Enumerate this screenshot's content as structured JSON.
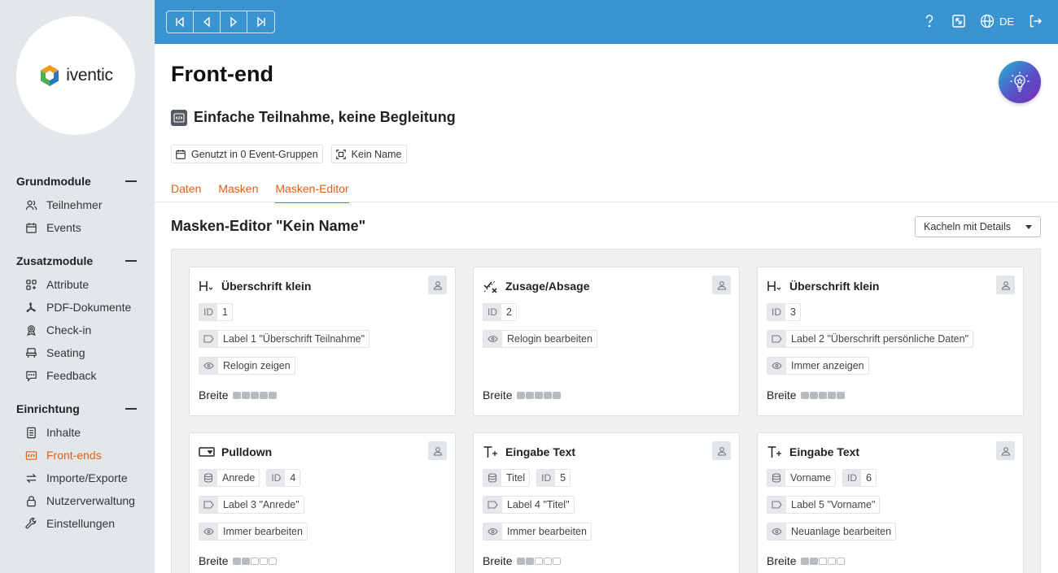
{
  "brand": {
    "name": "iventic"
  },
  "sidebar": {
    "groups": [
      {
        "title": "Grundmodule",
        "items": [
          {
            "label": "Teilnehmer",
            "icon": "users-icon"
          },
          {
            "label": "Events",
            "icon": "calendar-icon"
          }
        ]
      },
      {
        "title": "Zusatzmodule",
        "items": [
          {
            "label": "Attribute",
            "icon": "grid-plus-icon"
          },
          {
            "label": "PDF-Dokumente",
            "icon": "pdf-icon"
          },
          {
            "label": "Check-in",
            "icon": "badge-icon"
          },
          {
            "label": "Seating",
            "icon": "seat-icon"
          },
          {
            "label": "Feedback",
            "icon": "feedback-icon"
          }
        ]
      },
      {
        "title": "Einrichtung",
        "items": [
          {
            "label": "Inhalte",
            "icon": "document-icon"
          },
          {
            "label": "Front-ends",
            "icon": "frontend-icon",
            "active": true
          },
          {
            "label": "Importe/Exporte",
            "icon": "swap-icon"
          },
          {
            "label": "Nutzerverwaltung",
            "icon": "lock-icon"
          },
          {
            "label": "Einstellungen",
            "icon": "wrench-icon"
          }
        ]
      }
    ]
  },
  "topbar": {
    "language": "DE",
    "accent": "#3a94d2"
  },
  "header": {
    "title": "Front-end",
    "subtitle": "Einfache Teilnahme, keine Begleitung",
    "meta": {
      "groups": "Genutzt in 0 Event-Gruppen",
      "name": "Kein Name"
    },
    "tabs": [
      "Daten",
      "Masken",
      "Masken-Editor"
    ],
    "active_tab": "Masken-Editor"
  },
  "editor": {
    "title": "Masken-Editor \"Kein Name\"",
    "view_select": "Kacheln mit Details",
    "width_label": "Breite",
    "cards": [
      {
        "title": "Überschrift klein",
        "icon": "heading-icon",
        "source": null,
        "id": "1",
        "label": "Label 1 \"Überschrift Teilnahme\"",
        "visibility": "Relogin zeigen",
        "width": 5
      },
      {
        "title": "Zusage/Absage",
        "icon": "accept-decline-icon",
        "source": null,
        "id": "2",
        "label": null,
        "visibility": "Relogin bearbeiten",
        "width": 5
      },
      {
        "title": "Überschrift klein",
        "icon": "heading-icon",
        "source": null,
        "id": "3",
        "label": "Label 2 \"Überschrift persönliche Daten\"",
        "visibility": "Immer anzeigen",
        "width": 5
      },
      {
        "title": "Pulldown",
        "icon": "dropdown-icon",
        "source": "Anrede",
        "id": "4",
        "label": "Label 3 \"Anrede\"",
        "visibility": "Immer bearbeiten",
        "width": 2
      },
      {
        "title": "Eingabe Text",
        "icon": "text-input-icon",
        "source": "Titel",
        "id": "5",
        "label": "Label 4 \"Titel\"",
        "visibility": "Immer bearbeiten",
        "width": 2
      },
      {
        "title": "Eingabe Text",
        "icon": "text-input-icon",
        "source": "Vorname",
        "id": "6",
        "label": "Label 5 \"Vorname\"",
        "visibility": "Neuanlage bearbeiten",
        "width": 2
      }
    ]
  },
  "colors": {
    "active": "#e85d12",
    "topbar": "#3a94d2"
  }
}
